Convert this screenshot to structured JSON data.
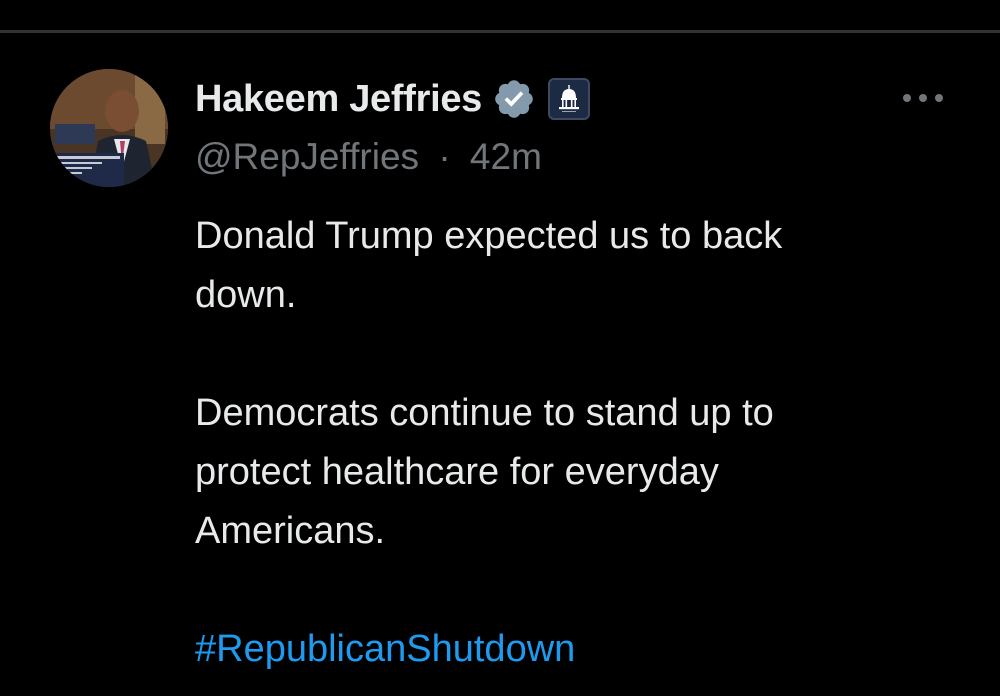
{
  "tweet": {
    "author": {
      "display_name": "Hakeem Jeffries",
      "handle": "@RepJeffries",
      "verified_icon": "verified-badge-icon",
      "affiliation_icon": "capitol-badge-icon"
    },
    "separator": "·",
    "time_ago": "42m",
    "body": {
      "line1": "Donald Trump expected us to back",
      "line2": "down.",
      "line3": "Democrats continue to stand up to",
      "line4": "protect healthcare for everyday",
      "line5": "Americans.",
      "hashtag": "#RepublicanShutdown"
    },
    "more_icon": "more-options-icon"
  },
  "colors": {
    "background": "#000000",
    "text": "#e7e9ea",
    "secondary_text": "#71767b",
    "link": "#1d9bf0",
    "verified_badge": "#829aab",
    "divider": "#2f3336"
  }
}
